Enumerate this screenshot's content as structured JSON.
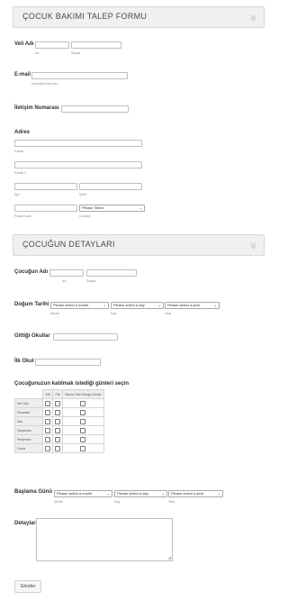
{
  "section1": {
    "title": "ÇOCUK BAKIMI TALEP FORMU",
    "icon": "chevron-down-icon"
  },
  "parent_name": {
    "label": "Veli Adı",
    "first_sub": "Ad",
    "last_sub": "Soyad"
  },
  "email": {
    "label": "E-mail",
    "sub": "ornek@ornek.com"
  },
  "phone": {
    "label": "İletişim Numarası"
  },
  "address": {
    "label": "Adres",
    "street_sub": "Sokak",
    "street2_sub": "Sokak 2",
    "district_sub": "İlçe",
    "city_sub": "Şehir",
    "postal_sub": "Posta Kodu",
    "country_sub": "Country",
    "country_value": "Please Select"
  },
  "section2": {
    "title": "ÇOCUĞUN DETAYLARI",
    "icon": "chevron-down-icon"
  },
  "child_name": {
    "label": "Çocuğun Adı",
    "first_sub": "Ad",
    "last_sub": "Soyad"
  },
  "birth_date": {
    "label": "Doğum Tarihi",
    "month_value": "Please select a month",
    "day_value": "Please select a day",
    "year_value": "Please select a year",
    "month_sub": "Month",
    "day_sub": "Day",
    "year_sub": "Year"
  },
  "school": {
    "label": "Gittiği Okullar"
  },
  "first_school": {
    "label": "İlk Okul"
  },
  "days": {
    "label": "Çocuğunuzun katılmak istediği günleri seçin",
    "columns": [
      "AM",
      "PM",
      "Okulun Tatil Olduğu Günler"
    ],
    "rows": [
      "Her Gün",
      "Pazartesi",
      "Salı",
      "Çarşamba",
      "Perşembe",
      "Cuma"
    ]
  },
  "start_date": {
    "label": "Başlama Günü",
    "month_value": "Please select a month",
    "day_value": "Please select a day",
    "year_value": "Please select a year",
    "month_sub": "Month",
    "day_sub": "Day",
    "year_sub": "Year"
  },
  "details": {
    "label": "Detaylar"
  },
  "submit": {
    "label": "Gönder"
  }
}
